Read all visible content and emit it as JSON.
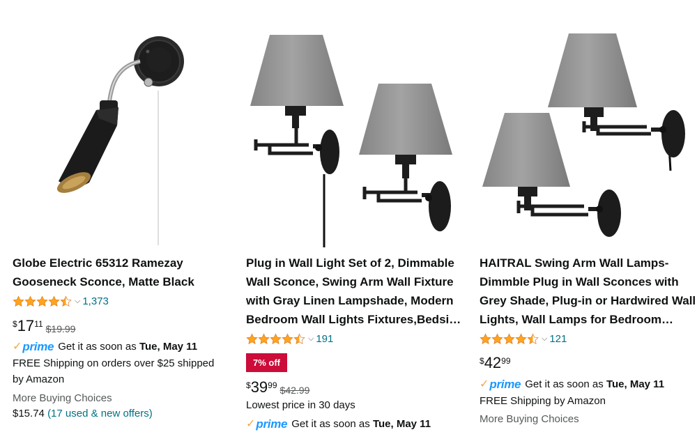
{
  "products": [
    {
      "title": "Globe Electric 65312 Ramezay Gooseneck Sconce, Matte Black",
      "rating_value": 4.5,
      "rating_count": "1,373",
      "price": {
        "currency": "$",
        "whole": "17",
        "fraction": "11",
        "list_price": "$19.99"
      },
      "prime_label": "prime",
      "delivery_prefix": "Get it as soon as",
      "delivery_date": "Tue, May 11",
      "shipping_line1": "FREE Shipping on orders over $25 shipped",
      "shipping_line2": "by Amazon",
      "more_choices_label": "More Buying Choices",
      "more_choices_price": "$15.74",
      "offers_link": "(17 used & new offers)"
    },
    {
      "title": "Plug in Wall Light Set of 2, Dimmable Wall Sconce, Swing Arm Wall Fixture with Gray Linen Lampshade, Modern Bedroom Wall Lights Fixtures,Bedside Lamp",
      "rating_value": 4.5,
      "rating_count": "191",
      "badge": "7% off",
      "price": {
        "currency": "$",
        "whole": "39",
        "fraction": "99",
        "list_price": "$42.99"
      },
      "price_note": "Lowest price in 30 days",
      "prime_label": "prime",
      "delivery_prefix": "Get it as soon as",
      "delivery_date": "Tue, May 11"
    },
    {
      "title": "HAITRAL Swing Arm Wall Lamps-Dimmble Plug in Wall Sconces with Grey Shade, Plug-in or Hardwired Wall Lights, Wall Lamps for Bedroom Living Room",
      "rating_value": 4.5,
      "rating_count": "121",
      "price": {
        "currency": "$",
        "whole": "42",
        "fraction": "99"
      },
      "prime_label": "prime",
      "delivery_prefix": "Get it as soon as",
      "delivery_date": "Tue, May 11",
      "shipping_line1": "FREE Shipping by Amazon",
      "more_choices_label": "More Buying Choices"
    }
  ],
  "icons": {
    "star": "star-icon",
    "chevron": "chevron-down-icon",
    "prime_check": "prime-check-icon"
  },
  "colors": {
    "star": "#ffa41c",
    "link": "#007185",
    "badge": "#cc0c39",
    "prime": "#1a98ff",
    "prime_check": "#f3a847"
  }
}
